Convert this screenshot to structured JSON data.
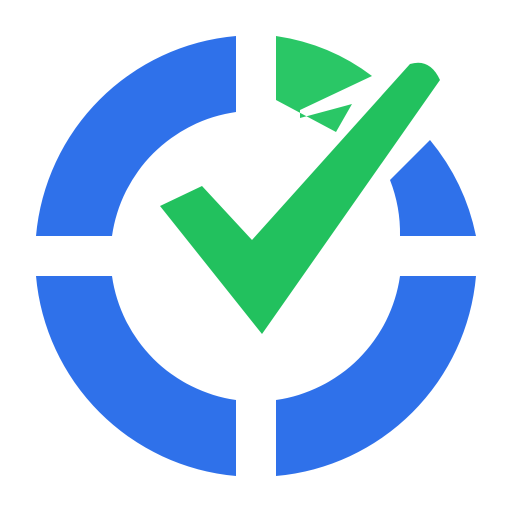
{
  "icon": {
    "name": "target-check-logo",
    "ring_color": "#2f71ea",
    "check_color": "#22c15e",
    "flag_color": "#2ac766",
    "background_color": "#ffffff"
  }
}
